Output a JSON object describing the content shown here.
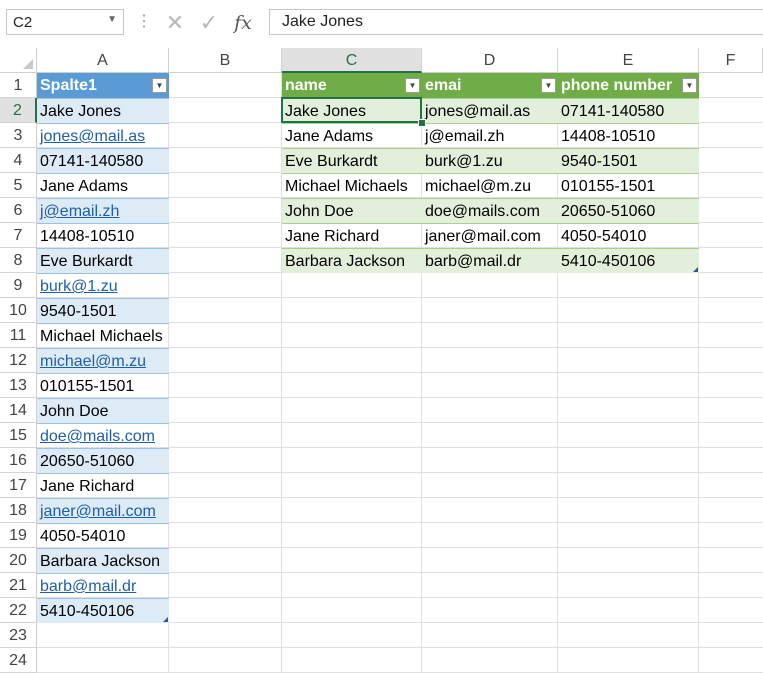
{
  "formula_bar": {
    "name_box": "C2",
    "content": "Jake Jones",
    "cancel_icon": "close-icon",
    "enter_icon": "check-icon",
    "function_icon": "fx-icon"
  },
  "columns": [
    "A",
    "B",
    "C",
    "D",
    "E",
    "F"
  ],
  "rows": [
    "1",
    "2",
    "3",
    "4",
    "5",
    "6",
    "7",
    "8",
    "9",
    "10",
    "11",
    "12",
    "13",
    "14",
    "15",
    "16",
    "17",
    "18",
    "19",
    "20",
    "21",
    "22",
    "23",
    "24"
  ],
  "selected_cell": "C2",
  "table1": {
    "header": "Spalte1",
    "cells": [
      {
        "text": "Jake Jones",
        "link": false
      },
      {
        "text": "jones@mail.as",
        "link": true
      },
      {
        "text": "07141-140580",
        "link": false
      },
      {
        "text": "Jane Adams",
        "link": false
      },
      {
        "text": "j@email.zh",
        "link": true
      },
      {
        "text": "14408-10510",
        "link": false
      },
      {
        "text": "Eve Burkardt",
        "link": false
      },
      {
        "text": "burk@1.zu",
        "link": true
      },
      {
        "text": "9540-1501",
        "link": false
      },
      {
        "text": "Michael Michaels",
        "link": false
      },
      {
        "text": "michael@m.zu",
        "link": true
      },
      {
        "text": "010155-1501",
        "link": false
      },
      {
        "text": "John Doe",
        "link": false
      },
      {
        "text": "doe@mails.com",
        "link": true
      },
      {
        "text": "20650-51060",
        "link": false
      },
      {
        "text": "Jane Richard",
        "link": false
      },
      {
        "text": "janer@mail.com",
        "link": true
      },
      {
        "text": "4050-54010",
        "link": false
      },
      {
        "text": "Barbara Jackson",
        "link": false
      },
      {
        "text": "barb@mail.dr",
        "link": true
      },
      {
        "text": "5410-450106",
        "link": false
      }
    ]
  },
  "table2": {
    "headers": [
      "name",
      "emai",
      "phone number"
    ],
    "rows": [
      [
        "Jake Jones",
        "jones@mail.as",
        "07141-140580"
      ],
      [
        "Jane Adams",
        "j@email.zh",
        "14408-10510"
      ],
      [
        "Eve Burkardt",
        "burk@1.zu",
        "9540-1501"
      ],
      [
        "Michael Michaels",
        "michael@m.zu",
        "010155-1501"
      ],
      [
        "John Doe",
        "doe@mails.com",
        "20650-51060"
      ],
      [
        "Jane Richard",
        "janer@mail.com",
        "4050-54010"
      ],
      [
        "Barbara Jackson",
        "barb@mail.dr",
        "5410-450106"
      ]
    ]
  },
  "colors": {
    "table1_header": "#5b9bd5",
    "table1_band": "#ddebf7",
    "table2_header": "#70ad47",
    "table2_band": "#e2efda",
    "selection": "#217346",
    "hyperlink": "#1f5fa8"
  }
}
